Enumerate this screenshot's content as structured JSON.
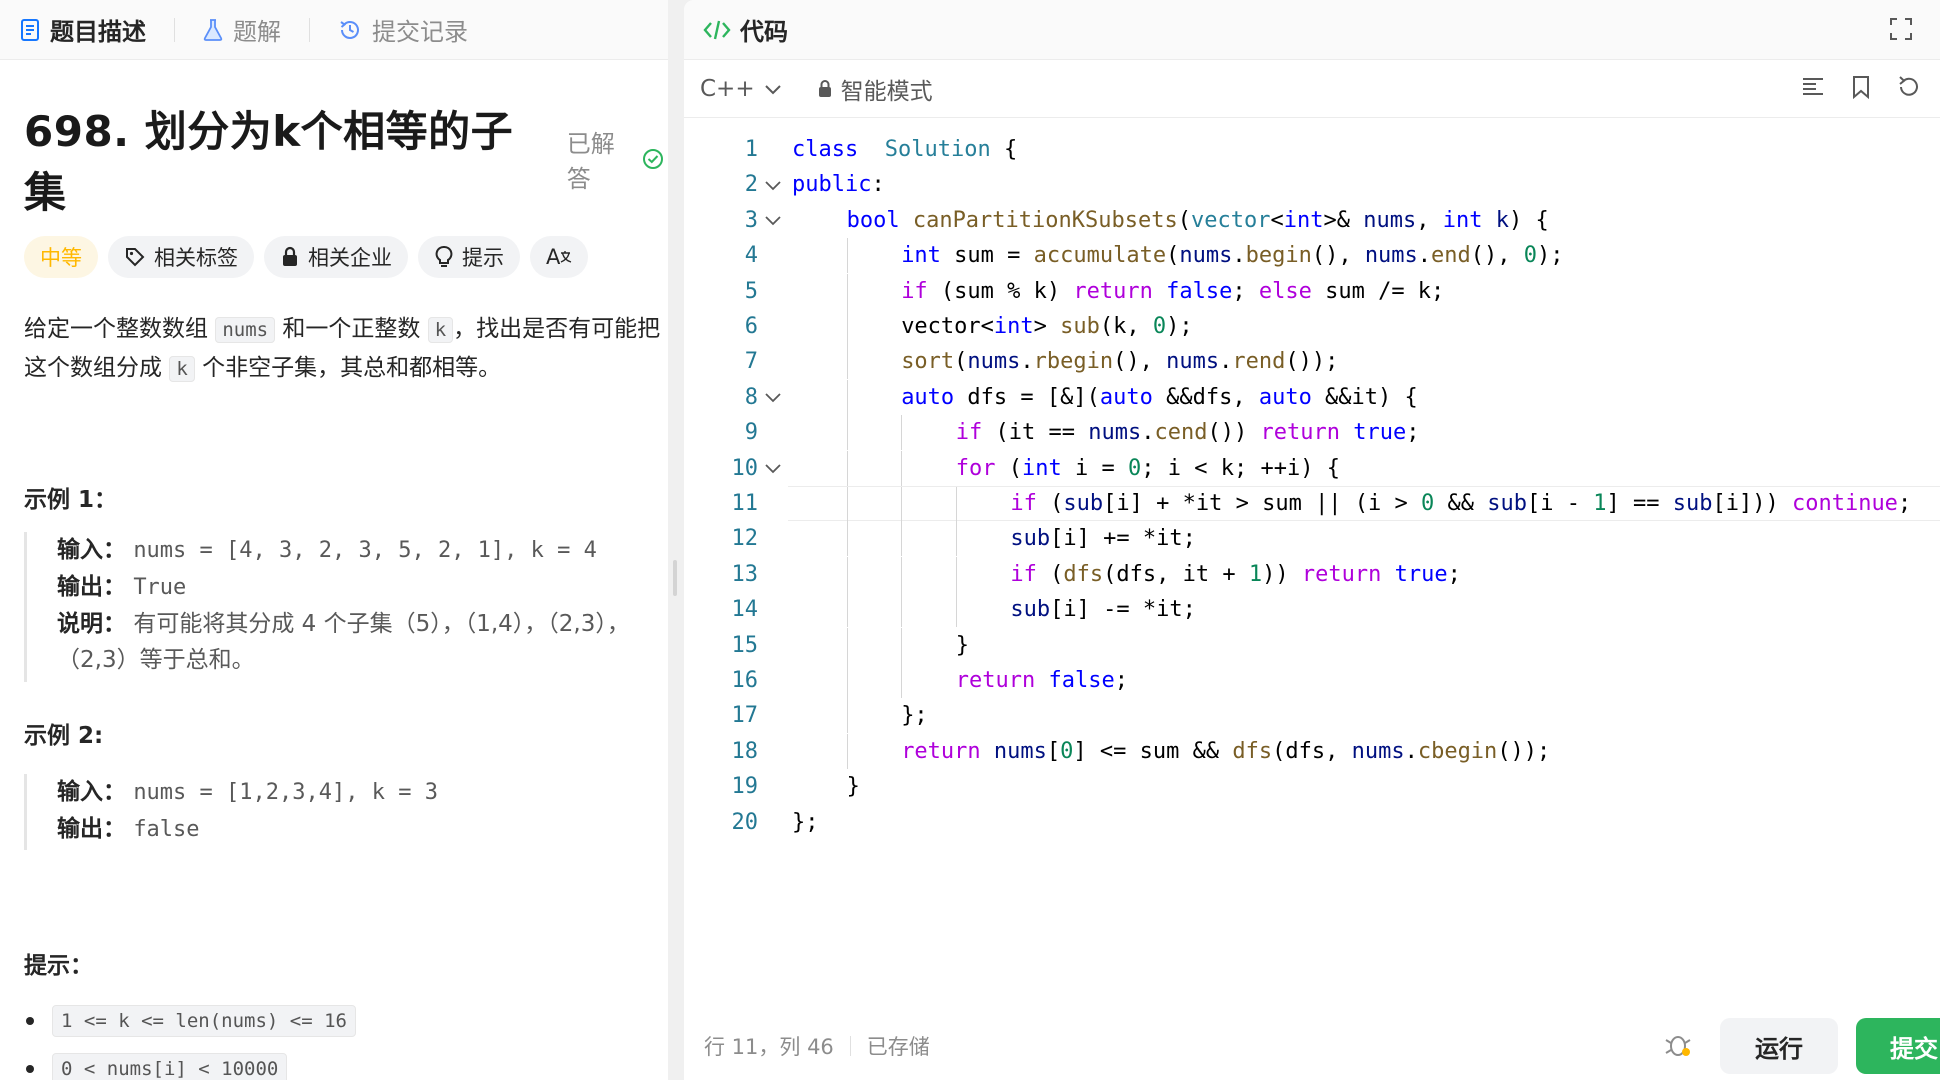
{
  "left_tabs": [
    {
      "label": "题目描述",
      "icon": "document-icon"
    },
    {
      "label": "题解",
      "icon": "flask-icon"
    },
    {
      "label": "提交记录",
      "icon": "history-icon"
    }
  ],
  "problem": {
    "title": "698. 划分为k个相等的子集",
    "status": "已解答"
  },
  "tags": {
    "difficulty": "中等",
    "related_tags": "相关标签",
    "related_companies": "相关企业",
    "hint": "提示",
    "translate": "A"
  },
  "description": {
    "part1": "给定一个整数数组 ",
    "code1": "nums",
    "part2": " 和一个正整数 ",
    "code2": "k",
    "part3": "，找出是否有可能把这个数组分成 ",
    "code3": "k",
    "part4": " 个非空子集，其总和都相等。"
  },
  "example1": {
    "heading": "示例 1：",
    "input_label": "输入：",
    "input_value": "nums = [4, 3, 2, 3, 5, 2, 1], k = 4",
    "output_label": "输出：",
    "output_value": "True",
    "explain_label": "说明：",
    "explain_value": "有可能将其分成 4 个子集（5），（1,4），（2,3），（2,3）等于总和。"
  },
  "example2": {
    "heading": "示例 2:",
    "input_label": "输入：",
    "input_value": "nums = [1,2,3,4], k = 3",
    "output_label": "输出：",
    "output_value": "false"
  },
  "hints_heading": "提示：",
  "constraints": [
    "1 <= k <= len(nums) <= 16",
    "0 < nums[i] < 10000"
  ],
  "editor": {
    "title": "代码",
    "language": "C++",
    "mode": "智能模式"
  },
  "code_lines": [
    {
      "n": "1",
      "tokens": [
        [
          "kw",
          "class"
        ],
        [
          "",
          "  "
        ],
        [
          "ty",
          "Solution"
        ],
        [
          "",
          " {"
        ]
      ]
    },
    {
      "n": "2",
      "tokens": [
        [
          "kw",
          "public"
        ],
        [
          "",
          ":"
        ]
      ]
    },
    {
      "n": "3",
      "tokens": [
        [
          "kw",
          "bool"
        ],
        [
          "",
          " "
        ],
        [
          "fn",
          "canPartitionKSubsets"
        ],
        [
          "",
          "("
        ],
        [
          "ty",
          "vector"
        ],
        [
          "",
          "<"
        ],
        [
          "kw",
          "int"
        ],
        [
          "",
          "&gt;&amp; "
        ],
        [
          "vr",
          "nums"
        ],
        [
          "",
          ", "
        ],
        [
          "kw",
          "int"
        ],
        [
          "",
          " "
        ],
        [
          "vr",
          "k"
        ],
        [
          "",
          ") {"
        ]
      ]
    },
    {
      "n": "4",
      "tokens": [
        [
          "kw",
          "int"
        ],
        [
          "",
          " sum = "
        ],
        [
          "fn",
          "accumulate"
        ],
        [
          "",
          "("
        ],
        [
          "vr",
          "nums"
        ],
        [
          "",
          "."
        ],
        [
          "fn",
          "begin"
        ],
        [
          "",
          "(), "
        ],
        [
          "vr",
          "nums"
        ],
        [
          "",
          "."
        ],
        [
          "fn",
          "end"
        ],
        [
          "",
          "(), "
        ],
        [
          "nm",
          "0"
        ],
        [
          "",
          ");"
        ]
      ]
    },
    {
      "n": "5",
      "tokens": [
        [
          "kw2",
          "if"
        ],
        [
          "",
          " (sum % k) "
        ],
        [
          "kw2",
          "return"
        ],
        [
          "",
          " "
        ],
        [
          "kw",
          "false"
        ],
        [
          "",
          "; "
        ],
        [
          "kw2",
          "else"
        ],
        [
          "",
          " sum /= k;"
        ]
      ]
    },
    {
      "n": "6",
      "tokens": [
        [
          "",
          "vector<"
        ],
        [
          "kw",
          "int"
        ],
        [
          "",
          "&gt; "
        ],
        [
          "fn",
          "sub"
        ],
        [
          "",
          "(k, "
        ],
        [
          "nm",
          "0"
        ],
        [
          "",
          ");"
        ]
      ]
    },
    {
      "n": "7",
      "tokens": [
        [
          "fn",
          "sort"
        ],
        [
          "",
          "("
        ],
        [
          "vr",
          "nums"
        ],
        [
          "",
          "."
        ],
        [
          "fn",
          "rbegin"
        ],
        [
          "",
          "(), "
        ],
        [
          "vr",
          "nums"
        ],
        [
          "",
          "."
        ],
        [
          "fn",
          "rend"
        ],
        [
          "",
          "());"
        ]
      ]
    },
    {
      "n": "8",
      "tokens": [
        [
          "kw",
          "auto"
        ],
        [
          "",
          " dfs = [&amp;]("
        ],
        [
          "kw",
          "auto"
        ],
        [
          "",
          " &amp;&amp;dfs, "
        ],
        [
          "kw",
          "auto"
        ],
        [
          "",
          " &amp;&amp;it) {"
        ]
      ]
    },
    {
      "n": "9",
      "tokens": [
        [
          "kw2",
          "if"
        ],
        [
          "",
          " (it == "
        ],
        [
          "vr",
          "nums"
        ],
        [
          "",
          "."
        ],
        [
          "fn",
          "cend"
        ],
        [
          "",
          "()) "
        ],
        [
          "kw2",
          "return"
        ],
        [
          "",
          " "
        ],
        [
          "kw",
          "true"
        ],
        [
          "",
          ";"
        ]
      ]
    },
    {
      "n": "10",
      "tokens": [
        [
          "kw2",
          "for"
        ],
        [
          "",
          " ("
        ],
        [
          "kw",
          "int"
        ],
        [
          "",
          " i = "
        ],
        [
          "nm",
          "0"
        ],
        [
          "",
          "; i < k; ++i) {"
        ]
      ]
    },
    {
      "n": "11",
      "tokens": [
        [
          "kw2",
          "if"
        ],
        [
          "",
          " ("
        ],
        [
          "vr",
          "sub"
        ],
        [
          "",
          "[i] + *it > sum || (i > "
        ],
        [
          "nm",
          "0"
        ],
        [
          "",
          " &amp;&amp; "
        ],
        [
          "vr",
          "sub"
        ],
        [
          "",
          "[i - "
        ],
        [
          "nm",
          "1"
        ],
        [
          "",
          "] == "
        ],
        [
          "vr",
          "sub"
        ],
        [
          "",
          "[i])) "
        ],
        [
          "kw2",
          "continue"
        ],
        [
          "",
          ";"
        ]
      ]
    },
    {
      "n": "12",
      "tokens": [
        [
          "vr",
          "sub"
        ],
        [
          "",
          "[i] += *it;"
        ]
      ]
    },
    {
      "n": "13",
      "tokens": [
        [
          "kw2",
          "if"
        ],
        [
          "",
          " ("
        ],
        [
          "fn",
          "dfs"
        ],
        [
          "",
          "(dfs, it + "
        ],
        [
          "nm",
          "1"
        ],
        [
          "",
          "))"
        ],
        [
          "",
          " "
        ],
        [
          "kw2",
          "return"
        ],
        [
          "",
          " "
        ],
        [
          "kw",
          "true"
        ],
        [
          "",
          ";"
        ]
      ]
    },
    {
      "n": "14",
      "tokens": [
        [
          "vr",
          "sub"
        ],
        [
          "",
          "[i] -= *it;"
        ]
      ]
    },
    {
      "n": "15",
      "tokens": [
        [
          "",
          "}"
        ]
      ]
    },
    {
      "n": "16",
      "tokens": [
        [
          "kw2",
          "return"
        ],
        [
          "",
          " "
        ],
        [
          "kw",
          "false"
        ],
        [
          "",
          ";"
        ]
      ]
    },
    {
      "n": "17",
      "tokens": [
        [
          "",
          "};"
        ]
      ]
    },
    {
      "n": "18",
      "tokens": [
        [
          "kw2",
          "return"
        ],
        [
          "",
          " "
        ],
        [
          "vr",
          "nums"
        ],
        [
          "",
          "["
        ],
        [
          "nm",
          "0"
        ],
        [
          "",
          "] <= sum &amp;&amp; "
        ],
        [
          "fn",
          "dfs"
        ],
        [
          "",
          "(dfs, "
        ],
        [
          "vr",
          "nums"
        ],
        [
          "",
          "."
        ],
        [
          "fn",
          "cbegin"
        ],
        [
          "",
          "());"
        ]
      ]
    },
    {
      "n": "19",
      "tokens": [
        [
          "",
          "}"
        ]
      ]
    },
    {
      "n": "20",
      "tokens": [
        [
          "",
          "};"
        ]
      ]
    }
  ],
  "status_bar": {
    "position": "行 11，列 46",
    "saved": "已存储"
  },
  "buttons": {
    "run": "运行",
    "submit": "提交"
  },
  "colors": {
    "accent_green": "#2db55d",
    "difficulty_yellow": "#ffb800"
  }
}
